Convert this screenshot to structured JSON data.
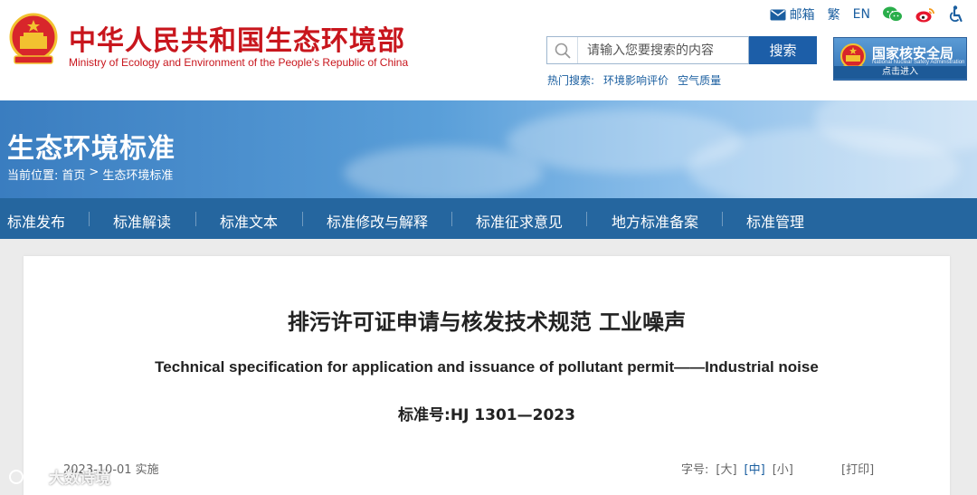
{
  "header": {
    "site_name_cn": "中华人民共和国生态环境部",
    "site_name_en": "Ministry of Ecology and Environment of the People's Republic of China",
    "toplinks": {
      "mail": "邮箱",
      "traditional": "繁",
      "english": "EN"
    },
    "search": {
      "placeholder": "请输入您要搜索的内容",
      "button": "搜索"
    },
    "hot_search": {
      "label": "热门搜索:",
      "keywords": [
        "环境影响评价",
        "空气质量"
      ]
    },
    "nnsa": {
      "name_cn": "国家核安全局",
      "name_en": "National Nuclear Safety Administration",
      "enter": "点击进入"
    }
  },
  "banner": {
    "title": "生态环境标准",
    "breadcrumb": {
      "prefix": "当前位置:",
      "home": "首页",
      "sep": ">",
      "current": "生态环境标准"
    }
  },
  "nav": {
    "items": [
      "标准发布",
      "标准解读",
      "标准文本",
      "标准修改与解释",
      "标准征求意见",
      "地方标准备案",
      "标准管理"
    ]
  },
  "article": {
    "title_cn": "排污许可证申请与核发技术规范 工业噪声",
    "title_en": "Technical specification for application and issuance of pollutant permit——Industrial noise",
    "standard_no": "标准号:HJ 1301—2023",
    "date": "2023-10-01 实施",
    "font_size": {
      "label": "字号:",
      "large": "[大]",
      "medium": "[中]",
      "small": "[小]"
    },
    "print": "[打印]"
  },
  "watermark": "大数诗境",
  "colors": {
    "brand_red": "#c8161d",
    "nav_blue": "#25669f",
    "link_blue": "#1b5fa0",
    "search_button": "#1c5ea8"
  }
}
